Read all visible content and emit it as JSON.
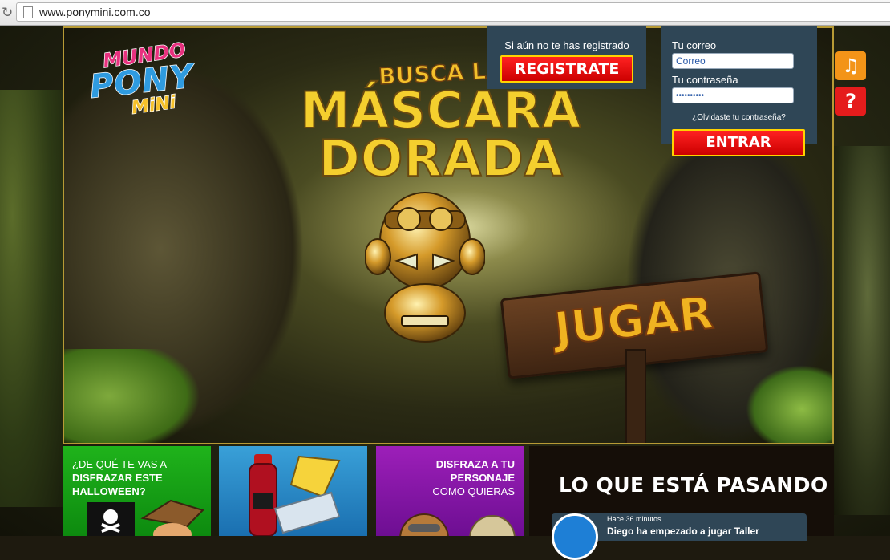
{
  "browser": {
    "url": "www.ponymini.com.co"
  },
  "logo": {
    "line1": "MUNDO",
    "line2": "PONY",
    "line3": "MiNi"
  },
  "hero": {
    "line1": "BUSCA LA",
    "line2": "MÁSCARA",
    "line3": "DORADA",
    "play_label": "JUGAR"
  },
  "register": {
    "prompt": "Si aún no te has registrado",
    "button_label": "REGISTRATE"
  },
  "login": {
    "email_label": "Tu correo",
    "email_value": "Correo",
    "password_label": "Tu contraseña",
    "password_value": "••••••••••",
    "forgot_label": "¿Olvidaste tu contraseña?",
    "submit_label": "ENTRAR"
  },
  "side_buttons": {
    "music_icon": "♫",
    "help_icon": "?"
  },
  "tiles": [
    {
      "lines": [
        "¿DE QUÉ TE VAS A",
        "DISFRAZAR ESTE",
        "HALLOWEEN?"
      ],
      "color": "#1fb31b"
    },
    {
      "color": "#39a0d8"
    },
    {
      "lines": [
        "DISFRAZA A TU",
        "PERSONAJE",
        "COMO QUIERAS"
      ],
      "color": "#9d1fb9"
    }
  ],
  "news": {
    "title": "LO QUE ESTÁ PASANDO",
    "items": [
      {
        "time": "Hace 36 minutos",
        "text": "Diego ha empezado a jugar Taller"
      }
    ]
  },
  "colors": {
    "panel": "#2f4656",
    "button_red": "#e51c1c",
    "button_border": "#ffd200",
    "frame_gold": "#b79a35"
  }
}
